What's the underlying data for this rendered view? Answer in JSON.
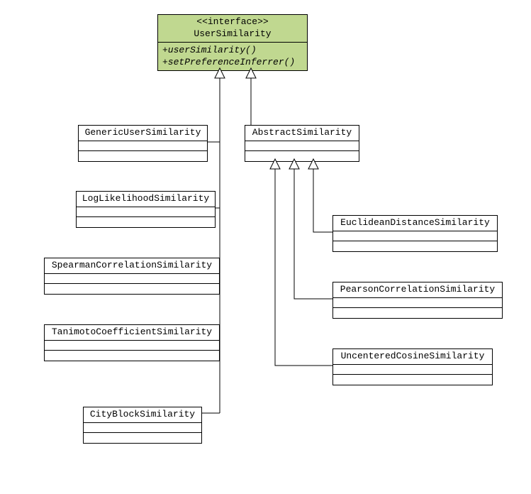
{
  "interface": {
    "stereotype": "<<interface>>",
    "name": "UserSimilarity",
    "methods": [
      "+userSimilarity()",
      "+setPreferenceInferrer()"
    ]
  },
  "classes": {
    "genericUserSimilarity": {
      "name": "GenericUserSimilarity"
    },
    "abstractSimilarity": {
      "name": "AbstractSimilarity"
    },
    "logLikelihood": {
      "name": "LogLikelihoodSimilarity"
    },
    "spearman": {
      "name": "SpearmanCorrelationSimilarity"
    },
    "tanimoto": {
      "name": "TanimotoCoefficientSimilarity"
    },
    "cityBlock": {
      "name": "CityBlockSimilarity"
    },
    "euclidean": {
      "name": "EuclideanDistanceSimilarity"
    },
    "pearson": {
      "name": "PearsonCorrelationSimilarity"
    },
    "uncentered": {
      "name": "UncenteredCosineSimilarity"
    }
  }
}
